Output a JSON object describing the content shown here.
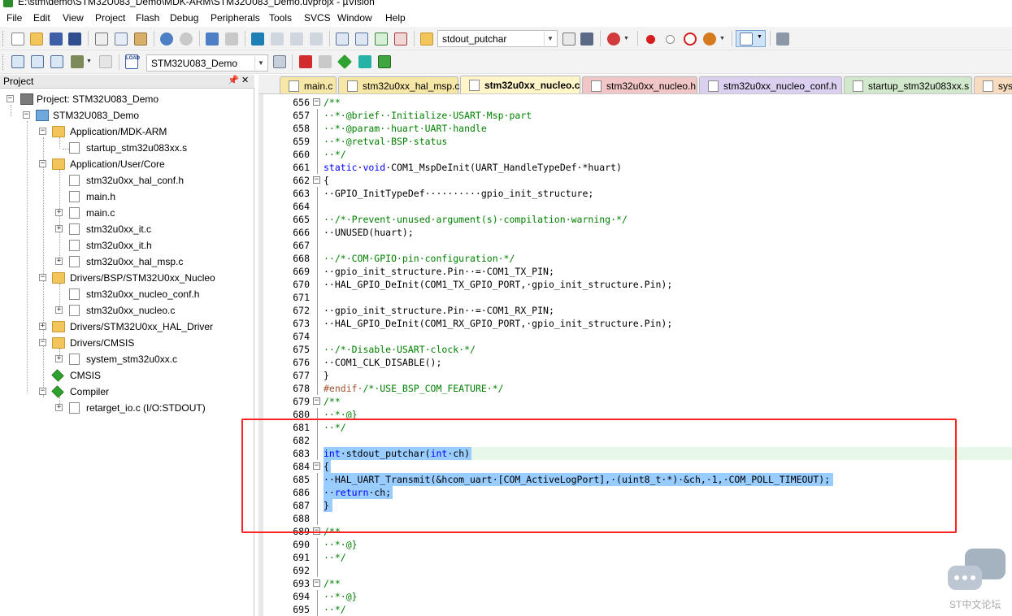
{
  "window": {
    "title": "E:\\stm\\demo\\STM32U083_Demo\\MDK-ARM\\STM32U083_Demo.uvprojx - µVision"
  },
  "menu": [
    "File",
    "Edit",
    "View",
    "Project",
    "Flash",
    "Debug",
    "Peripherals",
    "Tools",
    "SVCS",
    "Window",
    "Help"
  ],
  "toolbar": {
    "find_combo": "stdout_putchar",
    "target_combo": "STM32U083_Demo",
    "load_label": "LOAD"
  },
  "project_panel": {
    "title": "Project",
    "pin": "ᵖ",
    "close": "×",
    "tree": [
      {
        "label": "Project: STM32U083_Demo"
      },
      {
        "label": "STM32U083_Demo"
      },
      {
        "label": "Application/MDK-ARM"
      },
      {
        "label": "startup_stm32u083xx.s"
      },
      {
        "label": "Application/User/Core"
      },
      {
        "label": "stm32u0xx_hal_conf.h"
      },
      {
        "label": "main.h"
      },
      {
        "label": "main.c"
      },
      {
        "label": "stm32u0xx_it.c"
      },
      {
        "label": "stm32u0xx_it.h"
      },
      {
        "label": "stm32u0xx_hal_msp.c"
      },
      {
        "label": "Drivers/BSP/STM32U0xx_Nucleo"
      },
      {
        "label": "stm32u0xx_nucleo_conf.h"
      },
      {
        "label": "stm32u0xx_nucleo.c"
      },
      {
        "label": "Drivers/STM32U0xx_HAL_Driver"
      },
      {
        "label": "Drivers/CMSIS"
      },
      {
        "label": "system_stm32u0xx.c"
      },
      {
        "label": "CMSIS"
      },
      {
        "label": "Compiler"
      },
      {
        "label": "retarget_io.c (I/O:STDOUT)"
      }
    ]
  },
  "tabs": [
    {
      "label": "main.c",
      "color": "#f7e7a6"
    },
    {
      "label": "stm32u0xx_hal_msp.c",
      "color": "#f7e7a6"
    },
    {
      "label": "stm32u0xx_nucleo.c",
      "color": "#fff5c8",
      "active": true
    },
    {
      "label": "stm32u0xx_nucleo.h",
      "color": "#f2c6c6"
    },
    {
      "label": "stm32u0xx_nucleo_conf.h",
      "color": "#dcd0f0"
    },
    {
      "label": "startup_stm32u083xx.s",
      "color": "#d2e8cc"
    },
    {
      "label": "sys",
      "color": "#f7dcc0"
    }
  ],
  "editor": {
    "lines": [
      {
        "n": "656",
        "fold": "⊟",
        "text": "/**"
      },
      {
        "n": "657",
        "text": "··*·@brief··Initialize·USART·Msp·part"
      },
      {
        "n": "658",
        "text": "··*·@param··huart·UART·handle"
      },
      {
        "n": "659",
        "text": "··*·@retval·BSP·status"
      },
      {
        "n": "660",
        "text": "··*/"
      },
      {
        "n": "661",
        "text": "static·void·COM1_MspDeInit(UART_HandleTypeDef·*huart)"
      },
      {
        "n": "662",
        "fold": "⊟",
        "text": "{"
      },
      {
        "n": "663",
        "text": "··GPIO_InitTypeDef··········gpio_init_structure;"
      },
      {
        "n": "664",
        "text": ""
      },
      {
        "n": "665",
        "text": "··/*·Prevent·unused·argument(s)·compilation·warning·*/"
      },
      {
        "n": "666",
        "text": "··UNUSED(huart);"
      },
      {
        "n": "667",
        "text": ""
      },
      {
        "n": "668",
        "text": "··/*·COM·GPIO·pin·configuration·*/"
      },
      {
        "n": "669",
        "text": "··gpio_init_structure.Pin··=·COM1_TX_PIN;"
      },
      {
        "n": "670",
        "text": "··HAL_GPIO_DeInit(COM1_TX_GPIO_PORT,·gpio_init_structure.Pin);"
      },
      {
        "n": "671",
        "text": ""
      },
      {
        "n": "672",
        "text": "··gpio_init_structure.Pin··=·COM1_RX_PIN;"
      },
      {
        "n": "673",
        "text": "··HAL_GPIO_DeInit(COM1_RX_GPIO_PORT,·gpio_init_structure.Pin);"
      },
      {
        "n": "674",
        "text": ""
      },
      {
        "n": "675",
        "text": "··/*·Disable·USART·clock·*/"
      },
      {
        "n": "676",
        "text": "··COM1_CLK_DISABLE();"
      },
      {
        "n": "677",
        "text": "}"
      },
      {
        "n": "678",
        "text": "#endif·/*·USE_BSP_COM_FEATURE·*/"
      },
      {
        "n": "679",
        "fold": "⊟",
        "text": "/**"
      },
      {
        "n": "680",
        "text": "··*·@}"
      },
      {
        "n": "681",
        "text": "··*/"
      },
      {
        "n": "682",
        "text": ""
      },
      {
        "n": "683",
        "text": "int·stdout_putchar(int·ch)"
      },
      {
        "n": "684",
        "fold": "⊟",
        "text": "{"
      },
      {
        "n": "685",
        "text": "··HAL_UART_Transmit(&hcom_uart·[COM_ActiveLogPort],·(uint8_t·*)·&ch,·1,·COM_POLL_TIMEOUT);"
      },
      {
        "n": "686",
        "text": "··return·ch;"
      },
      {
        "n": "687",
        "text": "}"
      },
      {
        "n": "688",
        "text": ""
      },
      {
        "n": "689",
        "fold": "⊟",
        "text": "/**"
      },
      {
        "n": "690",
        "text": "··*·@}"
      },
      {
        "n": "691",
        "text": "··*/"
      },
      {
        "n": "692",
        "text": ""
      },
      {
        "n": "693",
        "fold": "⊟",
        "text": "/**"
      },
      {
        "n": "694",
        "text": "··*·@}"
      },
      {
        "n": "695",
        "text": "··*/"
      }
    ]
  },
  "watermark": "ST中文论坛",
  "colors": {
    "comment": "#008000",
    "keyword": "#0000ff",
    "preproc": "#a0522d",
    "selection": "#99ccff",
    "highlight": "#e8f8e8",
    "annotation_box": "#ff2222"
  }
}
